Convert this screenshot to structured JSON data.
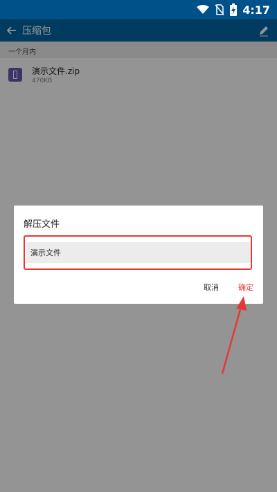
{
  "status_bar": {
    "time": "4:17"
  },
  "app_bar": {
    "title": "压缩包"
  },
  "section": {
    "label": "一个月内"
  },
  "file": {
    "name": "演示文件.zip",
    "size": "470KB"
  },
  "dialog": {
    "title": "解压文件",
    "input_value": "演示文件",
    "cancel_label": "取消",
    "confirm_label": "确定"
  },
  "colors": {
    "status_bar": "#00508a",
    "app_bar": "#0266a6",
    "accent_red": "#e53935",
    "file_icon": "#6b58b6"
  },
  "icons": [
    "wifi-icon",
    "no-sim-icon",
    "battery-charging-icon",
    "back-arrow-icon",
    "edit-icon",
    "zip-file-icon"
  ]
}
